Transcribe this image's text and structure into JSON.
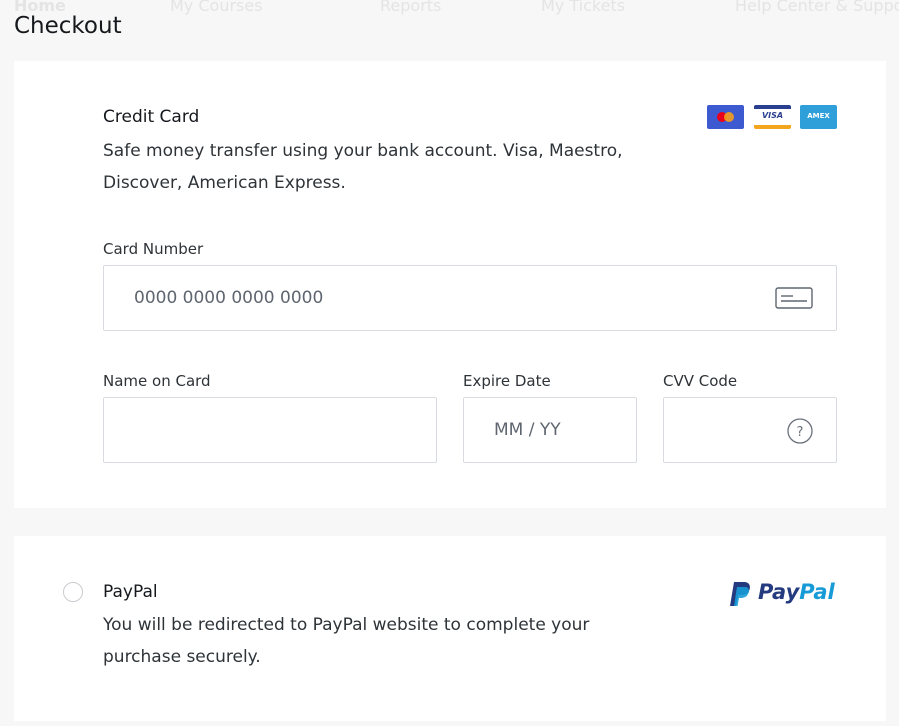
{
  "nav": {
    "items": [
      "Home",
      "My Courses",
      "Reports",
      "My Tickets",
      "Help Center & Support"
    ]
  },
  "page": {
    "title": "Checkout"
  },
  "credit_card": {
    "heading": "Credit Card",
    "description_line1": "Safe money transfer using your bank account. Visa, Maestro,",
    "description_line2": "Discover, American Express.",
    "brands": [
      {
        "name": "mastercard",
        "color": "#3d5ad1",
        "text": ""
      },
      {
        "name": "visa",
        "color": "#2a3f8f",
        "text": "VISA"
      },
      {
        "name": "amex",
        "color": "#2e9fd9",
        "text": "AMEX"
      }
    ],
    "card_number_label": "Card Number",
    "card_number_placeholder": "0000 0000 0000 0000",
    "name_label": "Name on Card",
    "name_value": "",
    "expire_label": "Expire Date",
    "expire_placeholder": "MM / YY",
    "cvv_label": "CVV Code",
    "cvv_value": ""
  },
  "paypal": {
    "heading": "PayPal",
    "description_line1": "You will be redirected to PayPal website to complete your",
    "description_line2": "purchase securely.",
    "logo_text": "PayPal",
    "logo_colors": {
      "dark": "#253b80",
      "light": "#179bd7"
    }
  }
}
